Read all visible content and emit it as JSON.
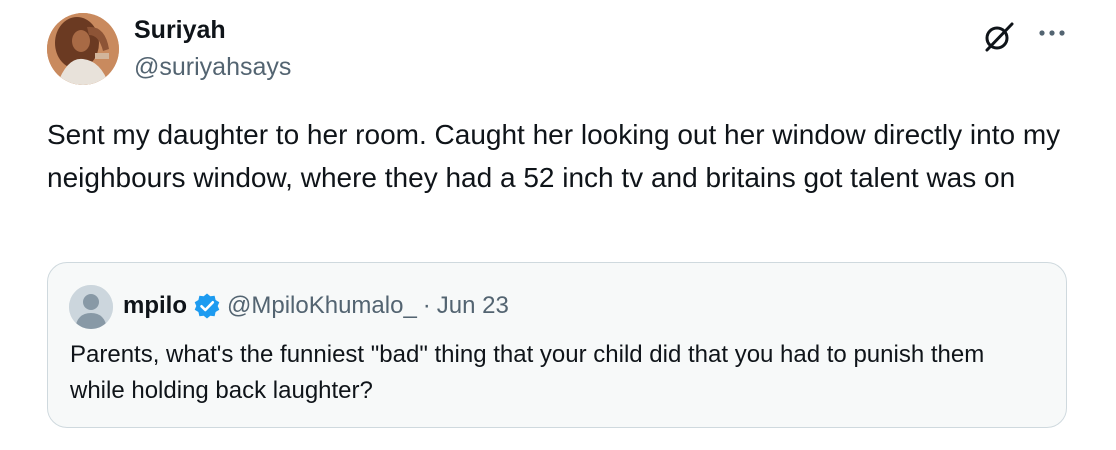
{
  "author": {
    "display_name": "Suriyah",
    "handle": "@suriyahsays",
    "avatar_icon": "profile-photo"
  },
  "tweet": {
    "text": "Sent my daughter to her room. Caught her looking out her window directly into my neighbours window, where they had a 52 inch tv and britains got talent was on"
  },
  "actions": {
    "grok_icon": "grok-icon",
    "more_icon": "more-options-icon"
  },
  "quoted": {
    "display_name": "mpilo",
    "verified": true,
    "verified_color": "#1d9bf0",
    "handle": "@MpiloKhumalo_",
    "separator": "·",
    "date": "Jun 23",
    "text": "Parents, what's the funniest \"bad\" thing that your child did that you had to punish them while holding back laughter?"
  }
}
